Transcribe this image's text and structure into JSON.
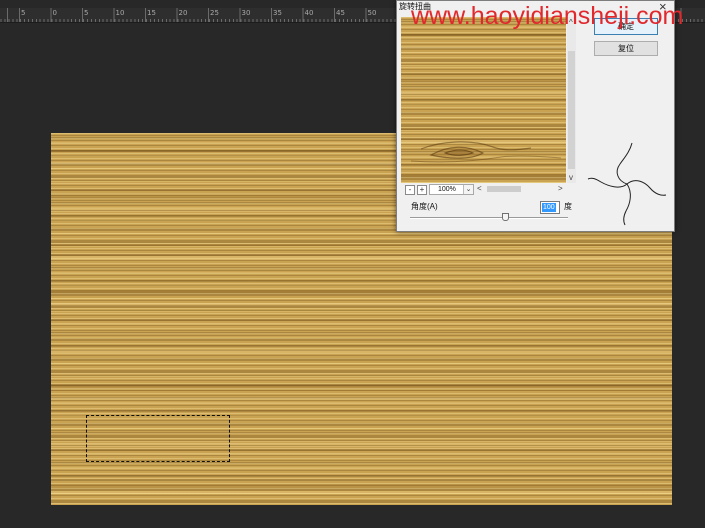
{
  "ruler": {
    "labels": [
      "5",
      "0",
      "5",
      "10",
      "15",
      "20",
      "25",
      "30",
      "35",
      "40",
      "45",
      "50"
    ]
  },
  "watermark": {
    "text": "www.haoyidiansheji.com"
  },
  "dialog": {
    "title": "旋转扭曲",
    "close_icon": "×",
    "ok_label": "确定",
    "reset_label": "复位",
    "zoom_out_icon": "-",
    "zoom_in_icon": "+",
    "zoom_value": "100%",
    "dropdown_icon": "⌄",
    "scroll_up_icon": "^",
    "scroll_down_icon": "v",
    "scroll_left_icon": "<",
    "scroll_right_icon": ">",
    "angle_label": "角度(A)",
    "angle_value": "100",
    "angle_unit": "度",
    "angle_slider_fraction": 0.6
  },
  "colors": {
    "background": "#282828",
    "watermark": "#e0282d",
    "text_selection": "#3399ff",
    "wood": "#c9a352",
    "default_button_border": "#3c7fb1"
  }
}
